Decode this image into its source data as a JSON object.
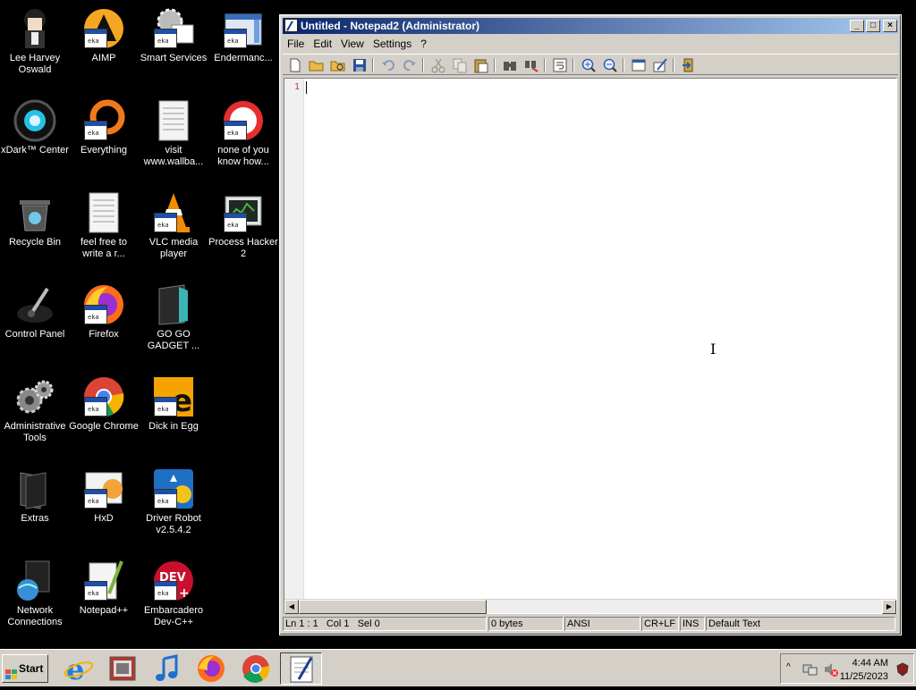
{
  "desktop": {
    "icons": [
      {
        "label": "Lee Harvey Oswald"
      },
      {
        "label": "AIMP"
      },
      {
        "label": "Smart Services"
      },
      {
        "label": "Endermanc..."
      },
      {
        "label": "xDark™ Center"
      },
      {
        "label": "Everything"
      },
      {
        "label": "visit www.wallba..."
      },
      {
        "label": "none of you know how..."
      },
      {
        "label": "Recycle Bin"
      },
      {
        "label": "feel free to write a r..."
      },
      {
        "label": "VLC media player"
      },
      {
        "label": "Process Hacker 2"
      },
      {
        "label": "Control Panel"
      },
      {
        "label": "Firefox"
      },
      {
        "label": "GO GO GADGET ..."
      },
      {
        "label": "Administrative Tools"
      },
      {
        "label": "Google Chrome"
      },
      {
        "label": "Dick in Egg"
      },
      {
        "label": "Extras"
      },
      {
        "label": "HxD"
      },
      {
        "label": "Driver Robot v2.5.4.2"
      },
      {
        "label": "Network Connections"
      },
      {
        "label": "Notepad++"
      },
      {
        "label": "Embarcadero Dev-C++"
      }
    ]
  },
  "window": {
    "title": "Untitled - Notepad2 (Administrator)",
    "menu": [
      "File",
      "Edit",
      "View",
      "Settings",
      "?"
    ],
    "line_number": "1",
    "status": {
      "position": "Ln 1 : 1   Col 1   Sel 0",
      "size": "0 bytes",
      "encoding": "ANSI",
      "eol": "CR+LF",
      "mode": "INS",
      "scheme": "Default Text"
    }
  },
  "taskbar": {
    "start_label": "Start",
    "clock_time": "4:44 AM",
    "clock_date": "11/25/2023"
  },
  "colors": {
    "titlebar_start": "#0a246a",
    "titlebar_end": "#a6caf0",
    "line_number": "#cc3333"
  }
}
